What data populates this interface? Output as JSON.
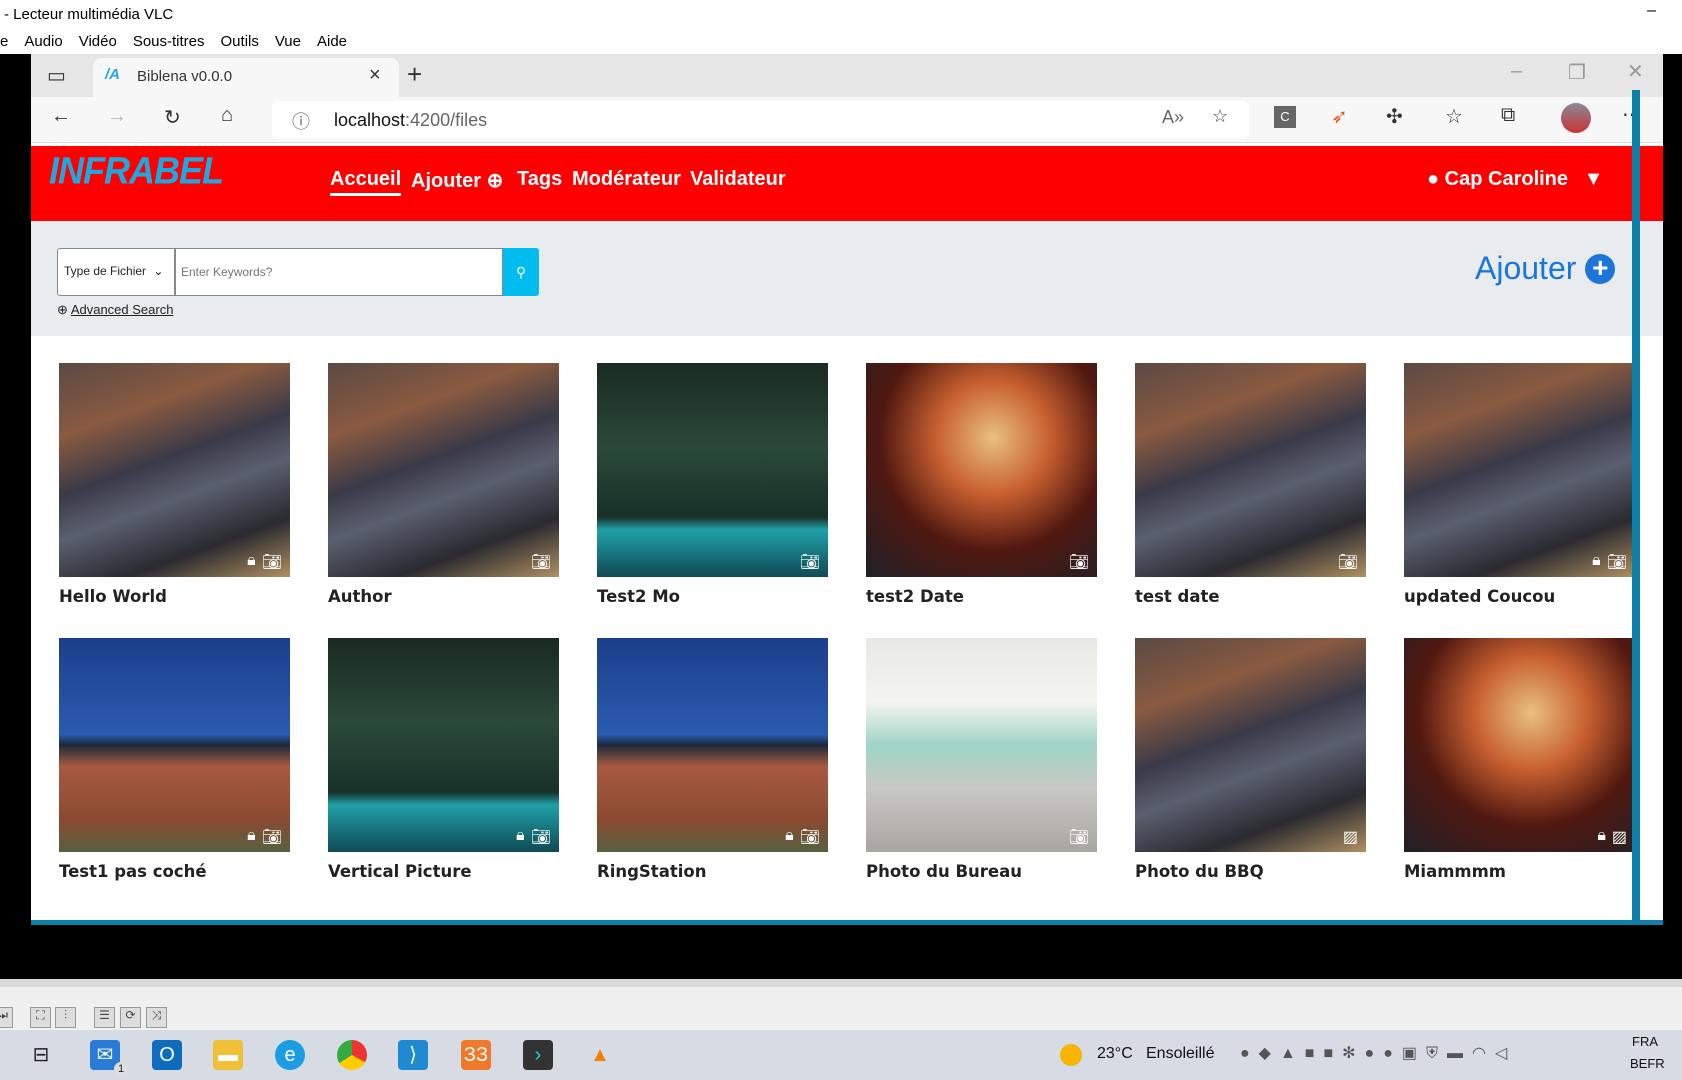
{
  "vlc": {
    "title": "- Lecteur multimédia VLC",
    "menu": [
      "e",
      "Audio",
      "Vidéo",
      "Sous-titres",
      "Outils",
      "Vue",
      "Aide"
    ]
  },
  "browser": {
    "tab_title": "Biblena v0.0.0",
    "url_host": "localhost",
    "url_path": ":4200/files"
  },
  "header": {
    "logo": "INFRABEL",
    "nav": [
      "Accueil",
      "Ajouter",
      "Tags",
      "Modérateur",
      "Validateur"
    ],
    "user": "Cap Caroline",
    "accent": "#fe0000"
  },
  "search": {
    "type_select": "Type de Fichier",
    "placeholder": "Enter Keywords?",
    "advanced": "Advanced Search",
    "add_label": "Ajouter"
  },
  "files": [
    {
      "title": "Hello World",
      "img": "bbq",
      "locked": true,
      "kind": "camera"
    },
    {
      "title": "Author",
      "img": "bbq",
      "locked": false,
      "kind": "camera"
    },
    {
      "title": "Test2 Mo",
      "img": "forest",
      "locked": false,
      "kind": "camera"
    },
    {
      "title": "test2 Date",
      "img": "lobster",
      "locked": false,
      "kind": "camera"
    },
    {
      "title": "test date",
      "img": "bbq",
      "locked": false,
      "kind": "camera"
    },
    {
      "title": "updated Coucou",
      "img": "bbq",
      "locked": true,
      "kind": "camera"
    },
    {
      "title": "Test1 pas coché",
      "img": "building",
      "locked": true,
      "kind": "camera"
    },
    {
      "title": "Vertical Picture",
      "img": "forest",
      "locked": true,
      "kind": "camera"
    },
    {
      "title": "RingStation",
      "img": "building",
      "locked": true,
      "kind": "camera"
    },
    {
      "title": "Photo du Bureau",
      "img": "office",
      "locked": false,
      "kind": "camera"
    },
    {
      "title": "Photo du BBQ",
      "img": "bbq",
      "locked": false,
      "kind": "image"
    },
    {
      "title": "Miammmm",
      "img": "lobster",
      "locked": true,
      "kind": "image"
    }
  ],
  "taskbar": {
    "weather": "23°C",
    "weather_desc": "Ensoleillé",
    "lang": "FRA",
    "layout": "BEFR",
    "mail_badge": "1"
  }
}
